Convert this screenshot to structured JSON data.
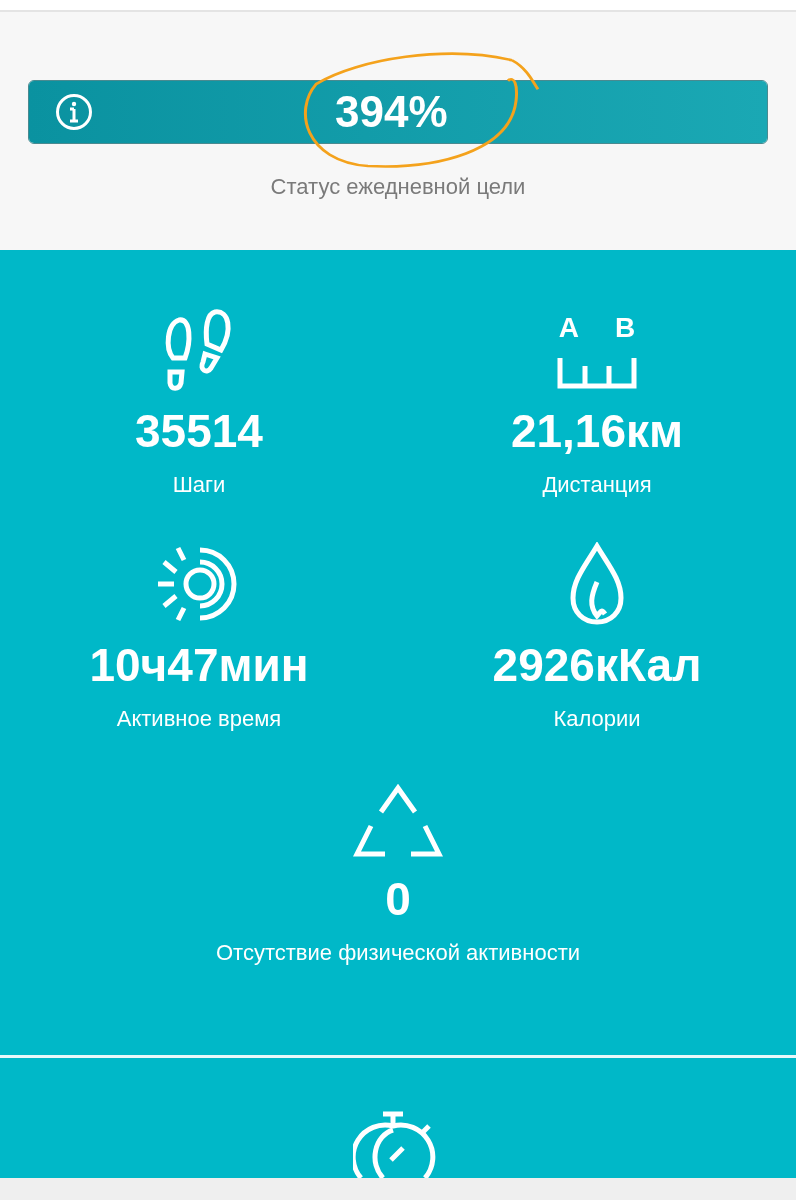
{
  "goal": {
    "value": "394%",
    "level": 1,
    "caption": "Статус ежедневной цели"
  },
  "metrics": [
    {
      "kind": "steps",
      "value": "35514",
      "label": "Шаги"
    },
    {
      "kind": "distance",
      "value": "21,16км",
      "label": "Дистанция",
      "icon_labels": [
        "A",
        "B"
      ]
    },
    {
      "kind": "active_time",
      "value": "10ч47мин",
      "label": "Активное время"
    },
    {
      "kind": "calories",
      "value": "2926кКал",
      "label": "Калории"
    },
    {
      "kind": "inactivity",
      "value": "0",
      "label": "Отсутствие физической активности"
    }
  ],
  "next_section": {
    "kind": "stopwatch"
  }
}
